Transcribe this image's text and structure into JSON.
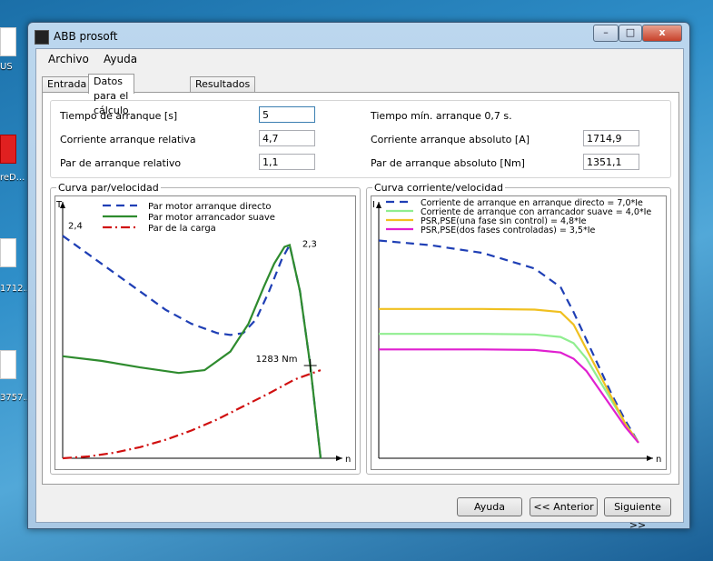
{
  "desktop": {
    "labels": [
      "US",
      "reD...",
      "1712...",
      "3757..."
    ]
  },
  "window": {
    "title": "ABB prosoft",
    "controls": {
      "minimize": "–",
      "maximize": "□",
      "close": "x"
    }
  },
  "menu": {
    "archivo": "Archivo",
    "ayuda": "Ayuda"
  },
  "tabs": {
    "entrada": "Entrada",
    "datos": "Datos para el cálculo",
    "resultados": "Resultados"
  },
  "form": {
    "tiempo_label": "Tiempo de arranque [s]",
    "tiempo_value": "5",
    "tiempo_min_label": "Tiempo mín. arranque  0,7 s.",
    "corriente_rel_label": "Corriente arranque relativa",
    "corriente_rel_value": "4,7",
    "corriente_abs_label": "Corriente arranque absoluto [A]",
    "corriente_abs_value": "1714,9",
    "par_rel_label": "Par de arranque relativo",
    "par_rel_value": "1,1",
    "par_abs_label": "Par de arranque absoluto [Nm]",
    "par_abs_value": "1351,1"
  },
  "chart_data": [
    {
      "type": "line",
      "title": "Curva par/velocidad",
      "ylabel": "T",
      "xlabel": "n",
      "legend": "top",
      "annotations": [
        "2,4",
        "2,3",
        "1283 Nm"
      ],
      "series": [
        {
          "name": "Par motor arranque directo",
          "color": "#1f3fb5",
          "style": "dashed",
          "x": [
            0,
            0.1,
            0.2,
            0.3,
            0.4,
            0.5,
            0.6,
            0.65,
            0.7,
            0.75,
            0.8,
            0.85,
            0.88,
            0.92,
            0.96,
            1.0
          ],
          "y": [
            2.4,
            2.2,
            2.0,
            1.8,
            1.6,
            1.45,
            1.35,
            1.33,
            1.35,
            1.5,
            1.8,
            2.15,
            2.3,
            1.8,
            1.0,
            0.0
          ]
        },
        {
          "name": "Par motor arrancador suave",
          "color": "#2e8b2e",
          "style": "solid",
          "x": [
            0,
            0.15,
            0.3,
            0.45,
            0.55,
            0.65,
            0.72,
            0.78,
            0.82,
            0.86,
            0.88,
            0.92,
            0.96,
            1.0
          ],
          "y": [
            1.1,
            1.05,
            0.98,
            0.92,
            0.95,
            1.15,
            1.45,
            1.85,
            2.1,
            2.28,
            2.3,
            1.8,
            1.0,
            0.0
          ]
        },
        {
          "name": "Par de la carga",
          "color": "#d01010",
          "style": "dashdot",
          "x": [
            0,
            0.1,
            0.2,
            0.3,
            0.4,
            0.5,
            0.6,
            0.7,
            0.8,
            0.9,
            1.0
          ],
          "y": [
            0.0,
            0.02,
            0.06,
            0.12,
            0.2,
            0.3,
            0.42,
            0.56,
            0.7,
            0.85,
            0.95
          ]
        }
      ]
    },
    {
      "type": "line",
      "title": "Curva corriente/velocidad",
      "ylabel": "I",
      "xlabel": "n",
      "legend": "top",
      "series": [
        {
          "name": "Corriente de arranque en arranque directo = 7,0*Ie",
          "color": "#1f3fb5",
          "style": "dashed",
          "x": [
            0,
            0.2,
            0.4,
            0.6,
            0.7,
            0.75,
            0.8,
            0.85,
            0.9,
            0.95,
            1.0
          ],
          "y": [
            7.0,
            6.85,
            6.6,
            6.1,
            5.5,
            4.7,
            3.8,
            2.9,
            2.0,
            1.2,
            0.5
          ]
        },
        {
          "name": "Corriente de arranque con arrancador suave = 4,0*Ie",
          "color": "#90ee90",
          "style": "solid",
          "x": [
            0,
            0.2,
            0.4,
            0.6,
            0.7,
            0.75,
            0.8,
            0.85,
            0.9,
            0.95,
            1.0
          ],
          "y": [
            4.0,
            4.0,
            4.0,
            3.98,
            3.9,
            3.7,
            3.2,
            2.5,
            1.8,
            1.1,
            0.5
          ]
        },
        {
          "name": "PSR,PSE(una fase sin control) = 4,8*Ie",
          "color": "#f0c020",
          "style": "solid",
          "x": [
            0,
            0.2,
            0.4,
            0.6,
            0.7,
            0.75,
            0.8,
            0.85,
            0.9,
            0.95,
            1.0
          ],
          "y": [
            4.8,
            4.8,
            4.8,
            4.78,
            4.7,
            4.3,
            3.5,
            2.7,
            1.9,
            1.1,
            0.5
          ]
        },
        {
          "name": "PSR,PSE(dos fases controladas) = 3,5*Ie",
          "color": "#e020d0",
          "style": "solid",
          "x": [
            0,
            0.2,
            0.4,
            0.6,
            0.7,
            0.75,
            0.8,
            0.85,
            0.9,
            0.95,
            1.0
          ],
          "y": [
            3.5,
            3.5,
            3.5,
            3.48,
            3.4,
            3.2,
            2.8,
            2.2,
            1.6,
            1.0,
            0.5
          ]
        }
      ]
    }
  ],
  "buttons": {
    "ayuda": "Ayuda",
    "anterior": "<< Anterior",
    "siguiente": "Siguiente >>"
  }
}
